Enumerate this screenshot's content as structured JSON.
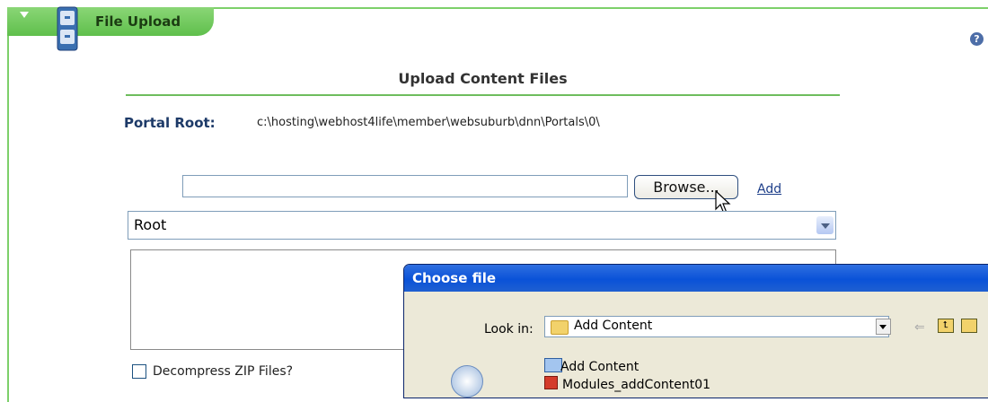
{
  "module": {
    "title": "File Upload"
  },
  "page": {
    "heading": "Upload Content Files",
    "portal_root_label": "Portal Root:",
    "portal_root_value": "c:\\hosting\\webhost4life\\member\\websuburb\\dnn\\Portals\\0\\"
  },
  "upload": {
    "browse_label": "Browse...",
    "add_label": "Add",
    "folder_selected": "Root",
    "decompress_label": "Decompress ZIP Files?",
    "decompress_checked": false
  },
  "dialog": {
    "title": "Choose file",
    "look_in_label": "Look in:",
    "look_in_value": "Add Content",
    "items": [
      "Add Content",
      "Modules_addContent01"
    ]
  },
  "colors": {
    "accent": "#6ebd5d",
    "link": "#1e3f8a",
    "dialog_title": "#0a52d8"
  }
}
